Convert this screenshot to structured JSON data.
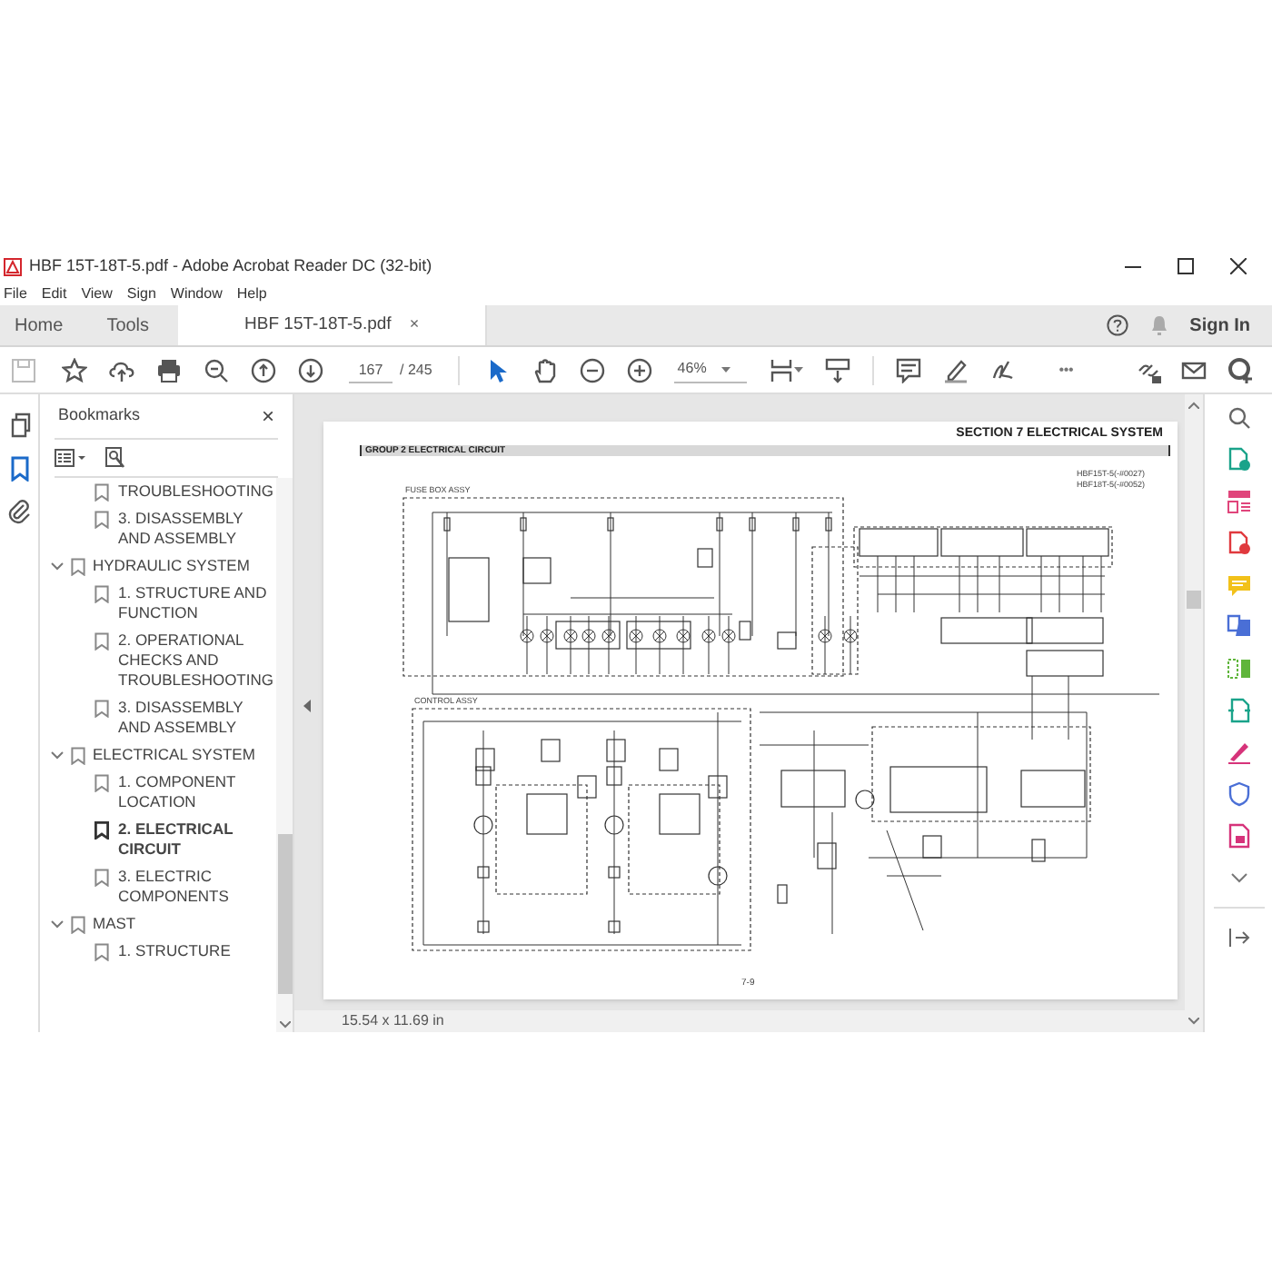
{
  "window": {
    "title": "HBF 15T-18T-5.pdf - Adobe Acrobat Reader DC (32-bit)"
  },
  "menu": [
    "File",
    "Edit",
    "View",
    "Sign",
    "Window",
    "Help"
  ],
  "tabs": [
    {
      "label": "Home",
      "selected": false
    },
    {
      "label": "Tools",
      "selected": false
    },
    {
      "label": "HBF 15T-18T-5.pdf",
      "selected": true,
      "close": "×"
    }
  ],
  "account": {
    "sign_in": "Sign In"
  },
  "toolbar": {
    "page": "167",
    "page_count": "/ 245",
    "zoom": "46%",
    "more": "•••"
  },
  "nav": [
    {
      "kind": "pages",
      "selected": false
    },
    {
      "kind": "bookmarks",
      "selected": true
    },
    {
      "kind": "attachments",
      "selected": false
    }
  ],
  "sidebar": {
    "title": "Bookmarks",
    "close": "×",
    "bookmarks": [
      {
        "children": [
          {
            "label": "TROUBLESHOOTING",
            "selected": false
          },
          {
            "label": "3. DISASSEMBLY AND ASSEMBLY",
            "selected": false
          }
        ]
      },
      {
        "label": "HYDRAULIC SYSTEM",
        "expanded": true,
        "children": [
          {
            "label": "1. STRUCTURE AND FUNCTION",
            "selected": false
          },
          {
            "label": "2. OPERATIONAL CHECKS AND TROUBLESHOOTING",
            "selected": false
          },
          {
            "label": "3. DISASSEMBLY AND ASSEMBLY",
            "selected": false
          }
        ]
      },
      {
        "label": "ELECTRICAL SYSTEM",
        "expanded": true,
        "children": [
          {
            "label": "1. COMPONENT LOCATION",
            "selected": false
          },
          {
            "label": "2. ELECTRICAL CIRCUIT",
            "selected": true
          },
          {
            "label": "3. ELECTRIC COMPONENTS",
            "selected": false
          }
        ]
      },
      {
        "label": "MAST",
        "expanded": true,
        "children": [
          {
            "label": "1. STRUCTURE",
            "selected": false
          }
        ]
      }
    ]
  },
  "document": {
    "section": "SECTION 7 ELECTRICAL SYSTEM",
    "group": "GROUP 2 ELECTRICAL CIRCUIT",
    "models": [
      "HBF15T-5(-#0027)",
      "HBF18T-5(-#0052)"
    ],
    "diagram_labels": [
      "FUSE BOX ASSY",
      "CONTROL ASSY"
    ],
    "page_number": "7-9"
  },
  "status_bar": {
    "page_size": "15.54 x 11.69 in"
  }
}
